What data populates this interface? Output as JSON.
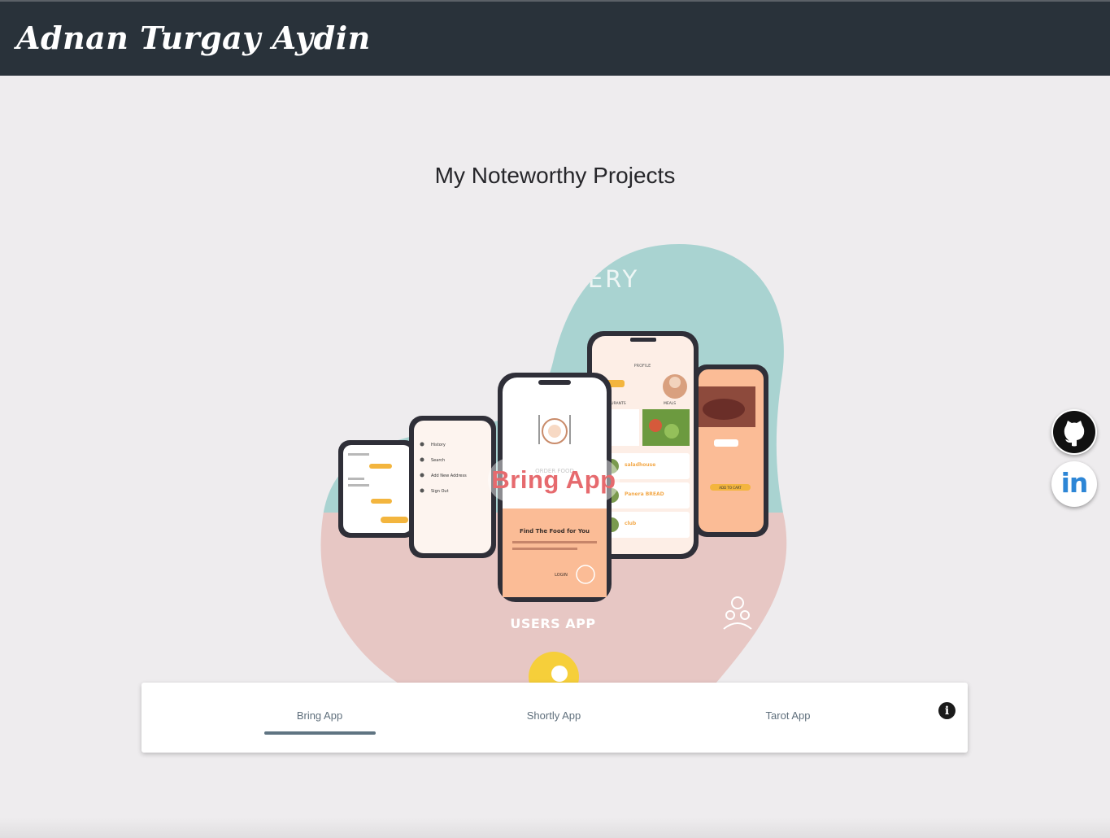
{
  "header": {
    "brand_name": "Adnan Turgay Aydin"
  },
  "main": {
    "title": "My Noteworthy Projects"
  },
  "carousel": {
    "current_slide_label": "Bring App",
    "image_text": {
      "banner_partial": "VERY",
      "users_app": "USERS APP",
      "order_food": "ORDER FOOD",
      "find_food": "Find The Food for You",
      "login": "LOGIN",
      "profile": "PROFILE",
      "restaurants": "RESTAURANTS",
      "meals": "MEALS",
      "menu_history": "History",
      "menu_search": "Search",
      "menu_add_address": "Add New Address",
      "menu_signout": "Sign Out",
      "restaurant_1": "saladhouse",
      "restaurant_2": "Panera BREAD",
      "restaurant_3": "club",
      "add_to_cart": "ADD TO CART"
    }
  },
  "tabs": {
    "items": [
      {
        "label": "Bring App"
      },
      {
        "label": "Shortly App"
      },
      {
        "label": "Tarot App"
      }
    ],
    "active_index": 0,
    "info_icon": "info-icon"
  },
  "social": {
    "github_icon": "github-icon",
    "linkedin_icon": "linkedin-icon",
    "linkedin_text": "in"
  },
  "colors": {
    "header_bg": "#29323a",
    "page_bg": "#eeecee",
    "blob_teal": "#a9d3d1",
    "blob_pink": "#e7c7c4",
    "accent_red": "#e66a6e",
    "phone_peach": "#fbbc96",
    "tab_indicator": "#5f7482"
  }
}
